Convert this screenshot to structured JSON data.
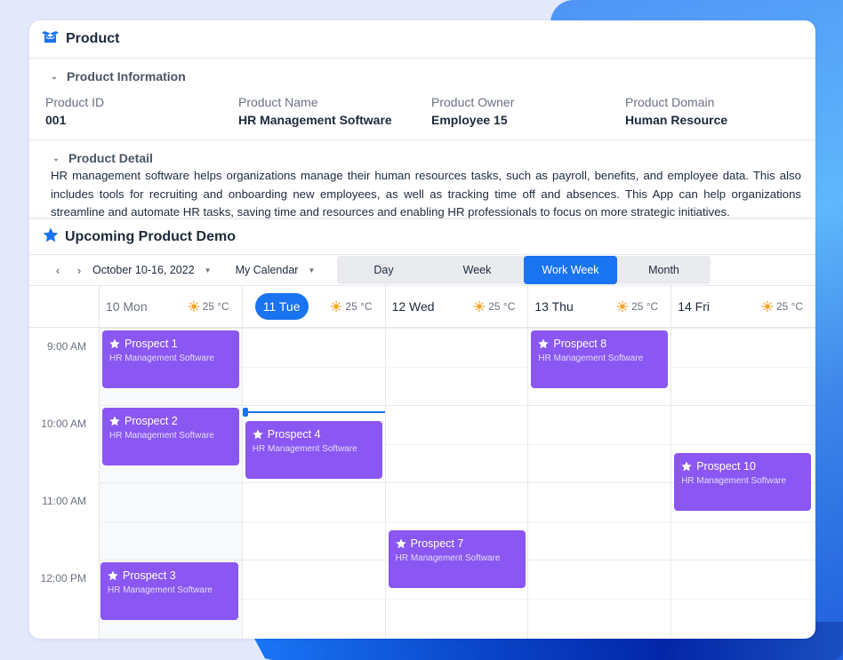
{
  "product": {
    "title": "Product",
    "icon": "box-icon",
    "information": {
      "heading": "Product Information",
      "fields": [
        {
          "label": "Product ID",
          "value": "001"
        },
        {
          "label": "Product Name",
          "value": "HR Management Software"
        },
        {
          "label": "Product Owner",
          "value": "Employee 15"
        },
        {
          "label": "Product Domain",
          "value": "Human Resource"
        }
      ]
    },
    "detail": {
      "heading": "Product Detail",
      "text": "HR management software helps organizations manage their human resources tasks, such as payroll, benefits, and employee data. This also includes tools for recruiting and onboarding new employees, as well as tracking time off and absences. This App can help organizations streamline and automate  HR tasks, saving time and resources and enabling HR professionals to focus on more strategic initiatives."
    }
  },
  "demo": {
    "title": "Upcoming Product Demo",
    "icon": "star-icon",
    "toolbar": {
      "prev_icon": "chevron-left-icon",
      "next_icon": "chevron-right-icon",
      "date_range": "October 10-16, 2022",
      "calendar": "My Calendar",
      "views": [
        "Day",
        "Week",
        "Work Week",
        "Month"
      ],
      "active_view": "Work Week"
    },
    "days": [
      {
        "label": "10 Mon",
        "temp": "25 °C",
        "state": "past"
      },
      {
        "label": "11 Tue",
        "temp": "25 °C",
        "state": "today"
      },
      {
        "label": "12 Wed",
        "temp": "25 °C",
        "state": "future"
      },
      {
        "label": "13 Thu",
        "temp": "25 °C",
        "state": "future"
      },
      {
        "label": "14 Fri",
        "temp": "25 °C",
        "state": "future"
      }
    ],
    "times": [
      "9:00 AM",
      "10:00 AM",
      "11:00 AM",
      "12:00 PM"
    ],
    "current_time": "10:05",
    "events": [
      {
        "title": "Prospect 1",
        "subtitle": "HR Management Software",
        "day": 0,
        "start": "9:00",
        "end": "9:45"
      },
      {
        "title": "Prospect 2",
        "subtitle": "HR Management Software",
        "day": 0,
        "start": "10:00",
        "end": "10:45"
      },
      {
        "title": "Prospect 3",
        "subtitle": "HR Management Software",
        "day": 0,
        "start": "12:00",
        "end": "12:45"
      },
      {
        "title": "Prospect 4",
        "subtitle": "HR Management Software",
        "day": 1,
        "start": "10:10",
        "end": "10:55"
      },
      {
        "title": "Prospect 7",
        "subtitle": "HR Management Software",
        "day": 2,
        "start": "11:35",
        "end": "12:20"
      },
      {
        "title": "Prospect 8",
        "subtitle": "HR Management Software",
        "day": 3,
        "start": "9:00",
        "end": "9:45"
      },
      {
        "title": "Prospect 10",
        "subtitle": "HR Management Software",
        "day": 4,
        "start": "10:35",
        "end": "11:20"
      }
    ]
  },
  "colors": {
    "accent": "#1a73f0",
    "event": "#8b57f2",
    "weather_sun": "#f5a623"
  }
}
